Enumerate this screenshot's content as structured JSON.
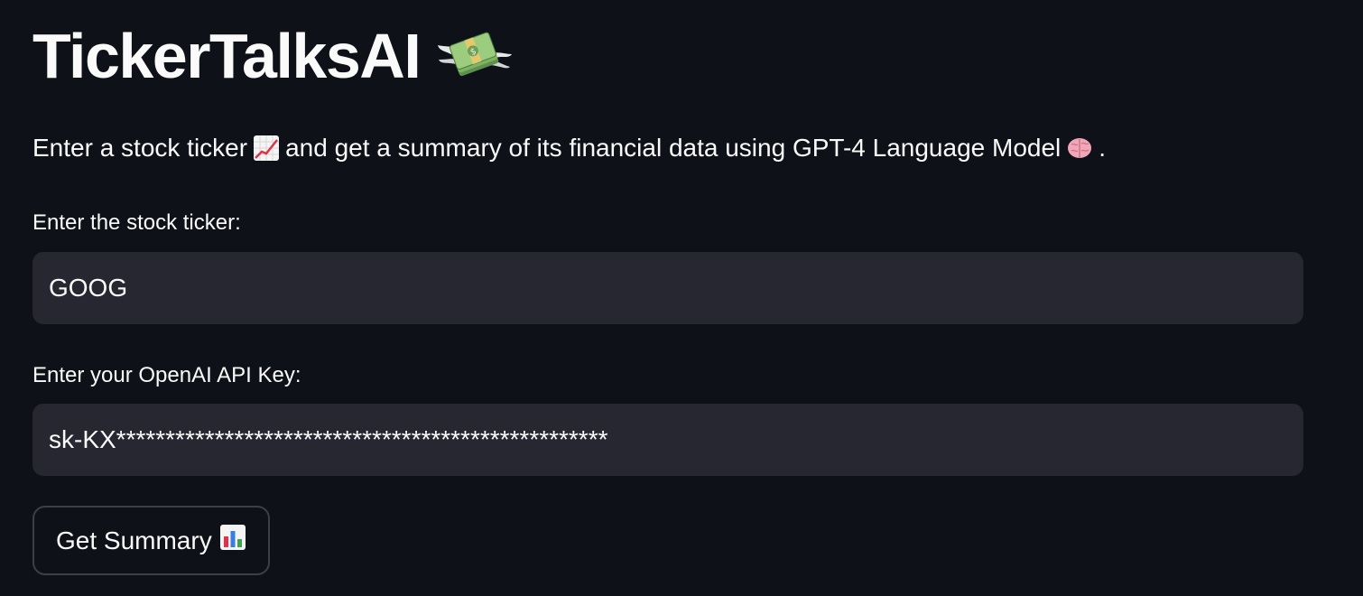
{
  "header": {
    "title": "TickerTalksAI",
    "title_icon": "money-with-wings-icon"
  },
  "intro": {
    "text_before": "Enter a stock ticker",
    "icon_1": "chart-increasing-icon",
    "text_middle": "and get a summary of its financial data using GPT-4 Language Model",
    "icon_2": "brain-icon",
    "text_after": "."
  },
  "form": {
    "ticker_label": "Enter the stock ticker:",
    "ticker_value": "GOOG",
    "api_key_label": "Enter your OpenAI API Key:",
    "api_key_value": "sk-KX**************************************************",
    "submit_label": "Get Summary",
    "submit_icon": "bar-chart-icon"
  },
  "colors": {
    "background": "#0e1117",
    "input_background": "#262730",
    "text": "#fafafa",
    "button_border": "#3c3f4a"
  }
}
